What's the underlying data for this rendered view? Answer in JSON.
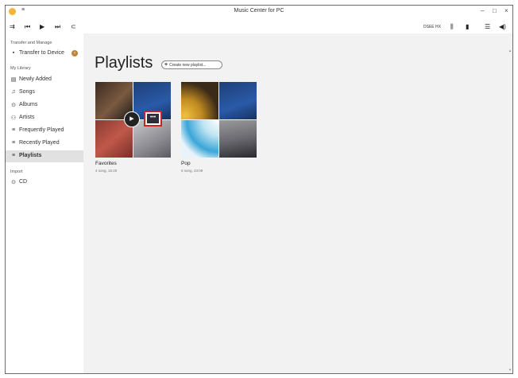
{
  "app": {
    "title": "Music Center for PC",
    "menu_glyph": "≡",
    "window_buttons": [
      "–",
      "□",
      "×"
    ]
  },
  "toolbar": {
    "icons": [
      "connect-icon",
      "previous-icon",
      "play-icon",
      "next-icon",
      "repeat-icon"
    ],
    "glyphs": [
      "⇉",
      "⏮",
      "▶",
      "⏭",
      "⊂"
    ],
    "sound_effect_label": "DSEE HX",
    "equalizer_glyph": "⫼",
    "device_glyph": "▮",
    "queue_glyph": "☰",
    "volume_glyph": "◀)",
    "time": "00:00/00:00"
  },
  "sidebar": {
    "transfer_header": "Transfer and Manage",
    "transfer_item": {
      "label": "Transfer to Device",
      "icon": "device-icon",
      "glyph": "▪",
      "badge": "›"
    },
    "library_header": "My Library",
    "library_items": [
      {
        "label": "Newly Added",
        "icon": "newly-added-icon",
        "glyph": "▤"
      },
      {
        "label": "Songs",
        "icon": "note-icon",
        "glyph": "♫"
      },
      {
        "label": "Albums",
        "icon": "album-icon",
        "glyph": "⊙"
      },
      {
        "label": "Artists",
        "icon": "artist-icon",
        "glyph": "⚇"
      },
      {
        "label": "Frequently Played",
        "icon": "playlist-icon",
        "glyph": "≡"
      },
      {
        "label": "Recently Played",
        "icon": "playlist-icon",
        "glyph": "≡"
      },
      {
        "label": "Playlists",
        "icon": "playlist-icon",
        "glyph": "≡",
        "selected": true
      }
    ],
    "import_header": "Import",
    "import_items": [
      {
        "label": "CD",
        "icon": "cd-icon",
        "glyph": "⊙"
      }
    ]
  },
  "main": {
    "title": "Playlists",
    "create_button": "Create new playlist...",
    "playlists": [
      {
        "name": "Favorites",
        "meta": "4 song, 16:20"
      },
      {
        "name": "Pop",
        "meta": "5 song, 23:09"
      }
    ],
    "play_glyph": "▶",
    "more_glyph": "•••"
  },
  "colors": {
    "accent_red": "#cc2222",
    "selection": "#e1e1e1",
    "content_bg": "#f2f2f2"
  }
}
